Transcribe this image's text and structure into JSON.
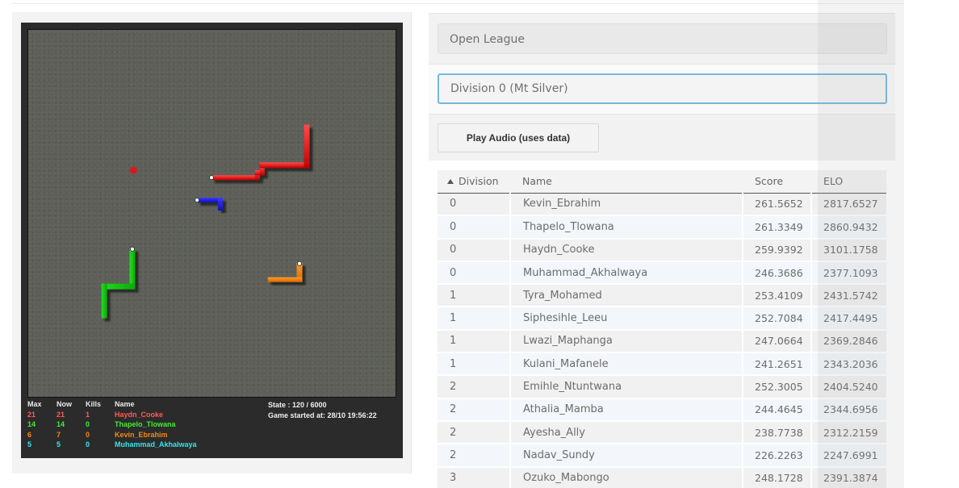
{
  "colors": {
    "red": "#ff5555",
    "green": "#33ee33",
    "orange": "#f08a1c",
    "cyan": "#33e6ee",
    "field_focus_border": "#75b9dc"
  },
  "game": {
    "headers": {
      "max": "Max",
      "now": "Now",
      "kills": "Kills",
      "name": "Name"
    },
    "players": [
      {
        "max": "21",
        "now": "21",
        "kills": "1",
        "name": "Haydn_Cooke",
        "color": "#ff5a5a"
      },
      {
        "max": "14",
        "now": "14",
        "kills": "0",
        "name": "Thapelo_Tlowana",
        "color": "#44ee33"
      },
      {
        "max": "6",
        "now": "7",
        "kills": "0",
        "name": "Kevin_Ebrahim",
        "color": "#f08a1c"
      },
      {
        "max": "5",
        "now": "5",
        "kills": "0",
        "name": "Muhammad_Akhalwaya",
        "color": "#33e6ee"
      }
    ],
    "state_text": "State : 120 / 6000",
    "started_text": "Game started at: 28/10 19:56:22",
    "apple_icon": "apple-dot"
  },
  "controls": {
    "league": "Open League",
    "division": "Division 0 (Mt Silver)",
    "audio_button": "Play Audio (uses data)"
  },
  "leaderboard": {
    "columns": {
      "division": "Division",
      "name": "Name",
      "score": "Score",
      "elo": "ELO"
    },
    "sort_icon": "sort-ascending-icon",
    "rows": [
      {
        "division": "0",
        "name": "Kevin_Ebrahim",
        "score": "261.5652",
        "elo": "2817.6527"
      },
      {
        "division": "0",
        "name": "Thapelo_Tlowana",
        "score": "261.3349",
        "elo": "2860.9432"
      },
      {
        "division": "0",
        "name": "Haydn_Cooke",
        "score": "259.9392",
        "elo": "3101.1758"
      },
      {
        "division": "0",
        "name": "Muhammad_Akhalwaya",
        "score": "246.3686",
        "elo": "2377.1093"
      },
      {
        "division": "1",
        "name": "Tyra_Mohamed",
        "score": "253.4109",
        "elo": "2431.5742"
      },
      {
        "division": "1",
        "name": "Siphesihle_Leeu",
        "score": "252.7084",
        "elo": "2417.4495"
      },
      {
        "division": "1",
        "name": "Lwazi_Maphanga",
        "score": "247.0664",
        "elo": "2369.2846"
      },
      {
        "division": "1",
        "name": "Kulani_Mafanele",
        "score": "241.2651",
        "elo": "2343.2036"
      },
      {
        "division": "2",
        "name": "Emihle_Ntuntwana",
        "score": "252.3005",
        "elo": "2404.5240"
      },
      {
        "division": "2",
        "name": "Athalia_Mamba",
        "score": "244.4645",
        "elo": "2344.6956"
      },
      {
        "division": "2",
        "name": "Ayesha_Ally",
        "score": "238.7738",
        "elo": "2312.2159"
      },
      {
        "division": "2",
        "name": "Nadav_Sundy",
        "score": "226.2263",
        "elo": "2247.6991"
      },
      {
        "division": "3",
        "name": "Ozuko_Mabongo",
        "score": "248.1728",
        "elo": "2391.3874"
      }
    ]
  }
}
